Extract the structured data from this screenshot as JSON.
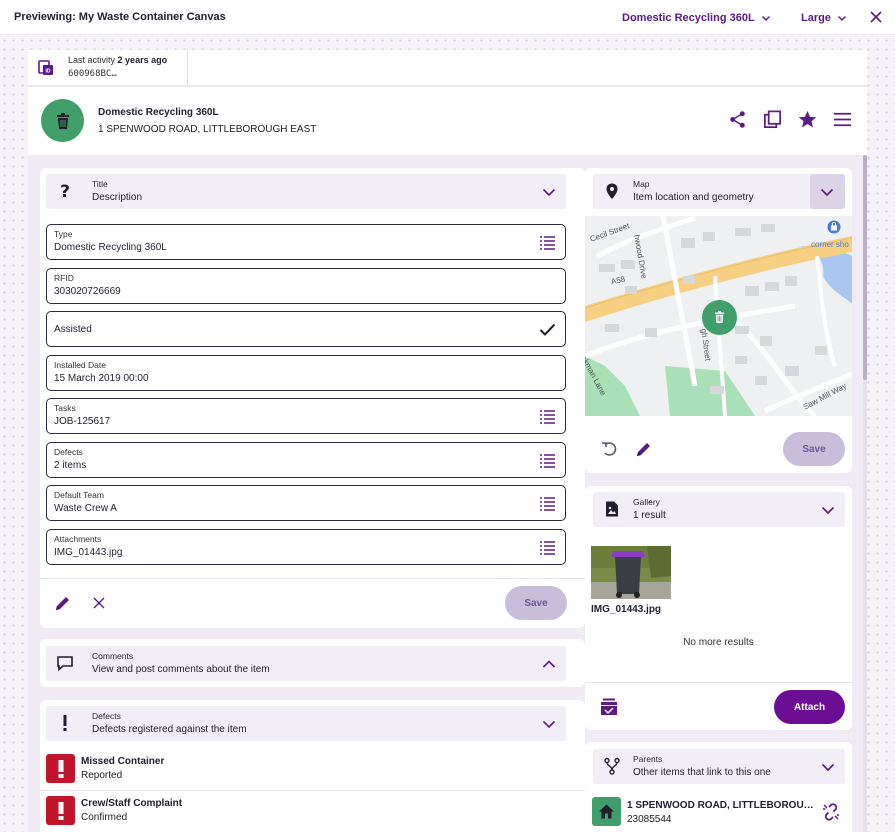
{
  "topbar": {
    "title": "Previewing: My Waste Container Canvas",
    "item_type": "Domestic Recycling 360L",
    "size": "Large"
  },
  "activity": {
    "label": "Last activity",
    "when": "2 years ago",
    "id": "600968BC…"
  },
  "header": {
    "name": "Domestic Recycling 360L",
    "address": "1 SPENWOOD ROAD, LITTLEBOROUGH EAST"
  },
  "details": {
    "title": "Title",
    "subtitle": "Description",
    "fields": [
      {
        "label": "Type",
        "value": "Domestic Recycling 360L"
      },
      {
        "label": "RFID",
        "value": "303020726669"
      },
      {
        "label": "",
        "value": "Assisted"
      },
      {
        "label": "Installed Date",
        "value": "15 March 2019 00:00"
      },
      {
        "label": "Tasks",
        "value": "JOB-125617"
      },
      {
        "label": "Defects",
        "value": "2 items"
      },
      {
        "label": "Default Team",
        "value": "Waste Crew A"
      },
      {
        "label": "Attachments",
        "value": "IMG_01443.jpg"
      }
    ],
    "save_label": "Save"
  },
  "comments": {
    "title": "Comments",
    "subtitle": "View and post comments about the item"
  },
  "defects": {
    "title": "Defects",
    "subtitle": "Defects registered against the item",
    "items": [
      {
        "title": "Missed Container",
        "status": "Reported"
      },
      {
        "title": "Crew/Staff Complaint",
        "status": "Confirmed"
      }
    ]
  },
  "map": {
    "title": "Map",
    "subtitle": "Item location and geometry",
    "labels": {
      "cecil": "Cecil Street",
      "hwood": "hwood Drive",
      "corner": "corner sho",
      "a58": "A58",
      "gh": "gh Street",
      "eakman": "eakman Lane",
      "sawmill": "Saw Mill Way"
    },
    "save_label": "Save"
  },
  "gallery": {
    "title": "Gallery",
    "subtitle": "1 result",
    "image_name": "IMG_01443.jpg",
    "no_more": "No more results",
    "attach_label": "Attach"
  },
  "parents": {
    "title": "Parents",
    "subtitle": "Other items that link to this one",
    "item_name": "1 SPENWOOD ROAD, LITTLEBOROU…",
    "item_id": "23085544"
  },
  "colors": {
    "accent": "#5b1a86",
    "primary_button": "#6a0f94",
    "disabled_button": "#c8bedc",
    "avatar_green": "#3f9e6a",
    "defect_red": "#c0152a"
  }
}
